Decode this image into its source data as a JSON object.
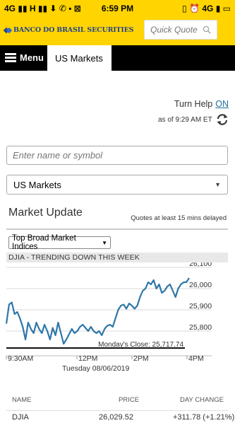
{
  "status_bar": {
    "left_icons": "4G ▮▮ H ▮▮ ⬇ ✆ ▪ ⊠",
    "time": "6:59 PM",
    "right_icons": "▯ ⏰ 4G ▮ ▭"
  },
  "brand": {
    "logo_text": "BANCO DO BRASIL SECURITIES",
    "quick_quote_placeholder": "Quick Quote",
    "brand_color": "#ffd400",
    "logo_color": "#24448c"
  },
  "nav": {
    "menu_label": "Menu",
    "active_tab": "US Markets"
  },
  "help": {
    "label": "Turn Help",
    "toggle": "ON",
    "as_of": "as of 9:29 AM ET"
  },
  "search": {
    "placeholder": "Enter name or symbol"
  },
  "market_select": {
    "value": "US Markets"
  },
  "market_update": {
    "title": "Market Update",
    "delay_note": "Quotes at least 15 mins delayed",
    "index_select": "Top Broad Market Indices",
    "trend_label": "DJIA - TRENDING DOWN THIS WEEK"
  },
  "chart_data": {
    "type": "line",
    "series": [
      {
        "values": [
          25835,
          25925,
          25935,
          25880,
          25890,
          25860,
          25820,
          25760,
          25840,
          25810,
          25790,
          25840,
          25810,
          25790,
          25830,
          25800,
          25760,
          25815,
          25780,
          25840,
          25790,
          25740,
          25760,
          25785,
          25810,
          25790,
          25800,
          25820,
          25830,
          25815,
          25800,
          25820,
          25800,
          25790,
          25800,
          25780,
          25810,
          25825,
          25830,
          25820,
          25860,
          25900,
          25920,
          25925,
          25905,
          25930,
          25920,
          25905,
          25920,
          25960,
          25990,
          26000,
          26030,
          26020,
          26040,
          26000,
          26020,
          25980,
          25990,
          26010,
          26020,
          25990,
          25960,
          26000,
          26020,
          26030,
          26030,
          26050
        ]
      }
    ],
    "x_ticks": [
      "9:30AM",
      "12PM",
      "2PM",
      "4PM"
    ],
    "x_date": "Tuesday 08/06/2019",
    "y_ticks": [
      26100,
      26000,
      25900,
      25800
    ],
    "ylim": [
      25730,
      26110
    ],
    "reference_line": {
      "label": "Monday's Close: 25,717.74",
      "value": 25717.74
    },
    "labels": {
      "x_ticks": [
        "9:30AM",
        "12PM",
        "2PM",
        "4PM"
      ],
      "y_ticks": [
        "26,100",
        "26,000",
        "25,900",
        "25,800"
      ],
      "close": "Monday's Close: 25,717.74",
      "date": "Tuesday 08/06/2019"
    },
    "line_color": "#2e77a8",
    "grid": true
  },
  "table": {
    "headers": {
      "name": "NAME",
      "price": "PRICE",
      "change": "DAY CHANGE"
    },
    "first_row": {
      "name": "DJIA",
      "price": "26,029.52",
      "change": "+311.78 (+1.21%)"
    }
  }
}
